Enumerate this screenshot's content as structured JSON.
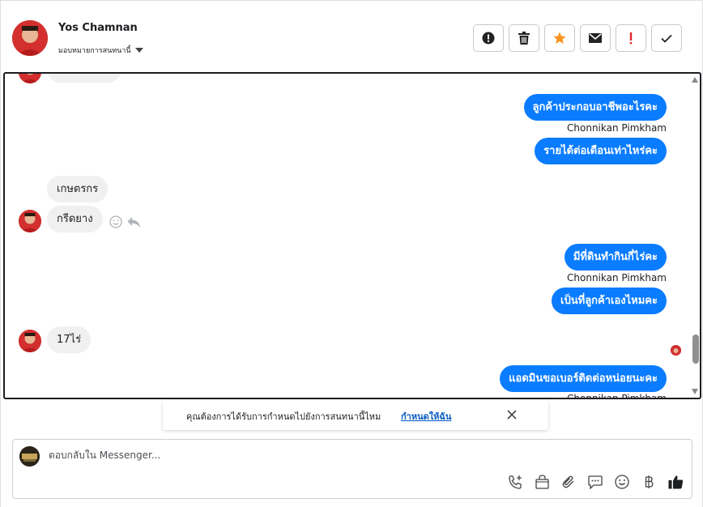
{
  "header": {
    "contact_name": "Yos Chamnan",
    "assign_label": "มอบหมายการสนทนานี้",
    "actions": [
      {
        "icon": "alert-circle-icon"
      },
      {
        "icon": "trash-icon"
      },
      {
        "icon": "star-icon",
        "color": "#f7931e"
      },
      {
        "icon": "mail-icon"
      },
      {
        "icon": "exclamation-icon",
        "color": "#e02424"
      },
      {
        "icon": "check-icon"
      }
    ]
  },
  "messages": {
    "out_1": "ลูกค้าประกอบอาชีพอะไรคะ",
    "out_1_sender": "Chonnikan Pimkham",
    "out_2": "รายได้ต่อเดือนเท่าไหร่คะ",
    "in_1": "เกษตรกร",
    "in_2": "กรีดยาง",
    "out_3": "มีที่ดินทำกินกี่ไร่คะ",
    "out_3_sender": "Chonnikan Pimkham",
    "out_4": "เป็นที่ลูกค้าเองไหมคะ",
    "in_3": "17ไร่",
    "out_5": "แอดมินขอเบอร์ติดต่อหน่อยนะคะ",
    "out_5_sender": "Chonnikan Pimkham"
  },
  "toast": {
    "text": "คุณต้องการได้รับการกำหนดไปยังการสนทนานี้ไหม",
    "link": "กำหนดให้ฉัน"
  },
  "composer": {
    "placeholder": "ตอบกลับใน Messenger..."
  },
  "colors": {
    "outgoing_bubble": "#0a7cff",
    "incoming_bubble": "#f0f0f0",
    "link": "#0a5dc2"
  }
}
